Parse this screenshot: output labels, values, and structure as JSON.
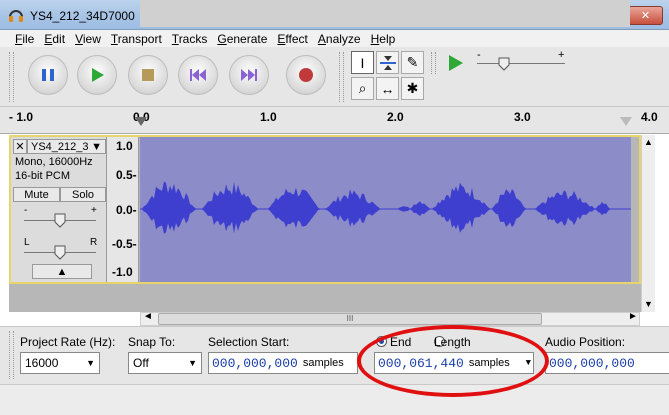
{
  "window": {
    "title": "YS4_212_34D7000",
    "controls": {
      "minimize": "—",
      "maximize": "□",
      "close": "✕"
    }
  },
  "menu": [
    "File",
    "Edit",
    "View",
    "Transport",
    "Tracks",
    "Generate",
    "Effect",
    "Analyze",
    "Help"
  ],
  "transport": [
    "pause",
    "play",
    "stop",
    "skip-start",
    "skip-end",
    "record"
  ],
  "tools": {
    "row1": [
      "I",
      "⇆",
      "✎"
    ],
    "row2": [
      "⌕",
      "↔",
      "✱"
    ]
  },
  "meter": {
    "minus": "-",
    "plus": "+"
  },
  "ruler": {
    "ticks": [
      "- 1.0",
      "0.0",
      "1.0",
      "2.0",
      "3.0",
      "4.0"
    ]
  },
  "track": {
    "name": "YS4_212_3",
    "format": "Mono, 16000Hz",
    "bitdepth": "16-bit PCM",
    "mute": "Mute",
    "solo": "Solo",
    "gain_minus": "-",
    "gain_plus": "+",
    "pan_left": "L",
    "pan_right": "R",
    "scale": [
      "1.0",
      "0.5-",
      "0.0-",
      "-0.5-",
      "-1.0"
    ]
  },
  "scrollbar": {
    "grip": "III"
  },
  "selection": {
    "project_rate_label": "Project Rate (Hz):",
    "project_rate_value": "16000",
    "snap_label": "Snap To:",
    "snap_value": "Off",
    "start_label": "Selection Start:",
    "start_value": "000,000,000",
    "start_unit": "samples",
    "end_option": "End",
    "length_option": "Length",
    "end_value": "000,061,440",
    "end_unit": "samples",
    "audio_pos_label": "Audio Position:",
    "audio_pos_value": "000,000,000"
  },
  "colors": {
    "waveform": "#3f3fcf",
    "wave_bg": "#8c8cc8",
    "highlight": "#e01010"
  }
}
